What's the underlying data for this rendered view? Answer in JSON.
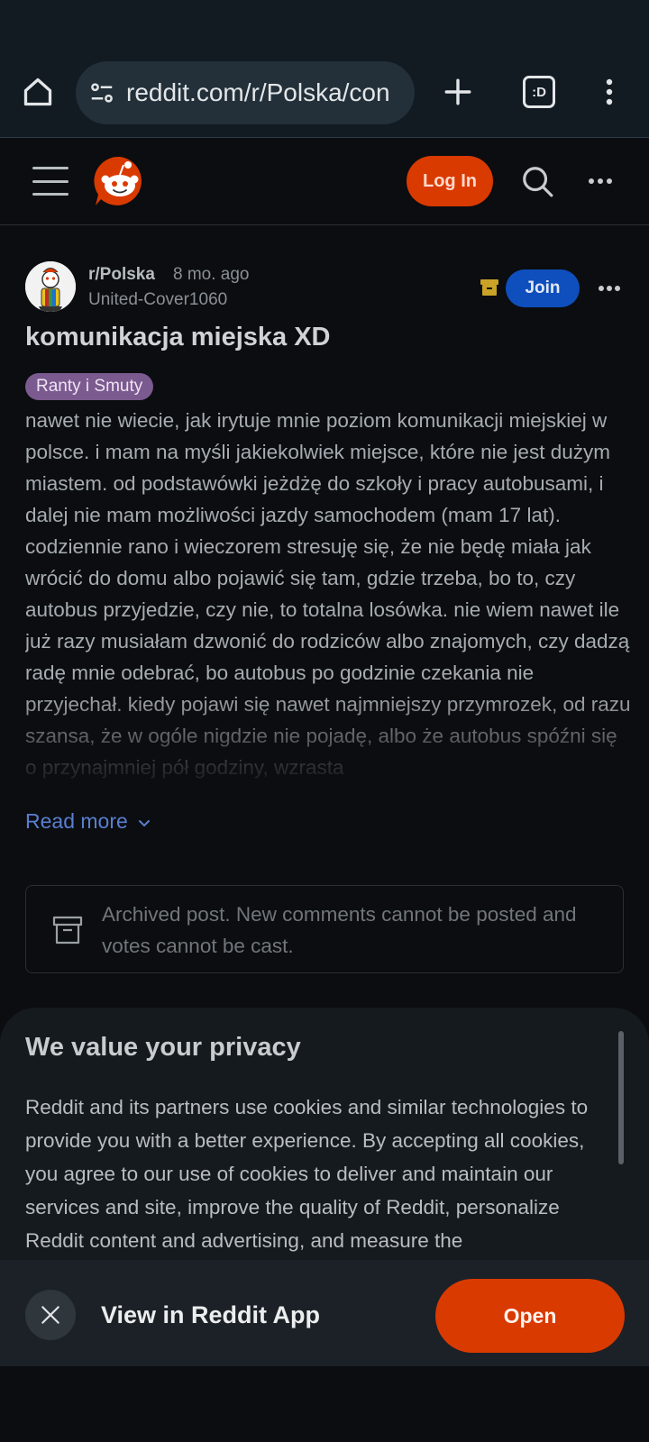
{
  "browser": {
    "url": "reddit.com/r/Polska/con",
    "tabs_label": ":D"
  },
  "header": {
    "login_label": "Log In"
  },
  "post": {
    "subreddit": "r/Polska",
    "time": "8 mo. ago",
    "author": "United-Cover1060",
    "join_label": "Join",
    "title": "komunikacja miejska XD",
    "flair": "Ranty i Smuty",
    "body": "nawet nie wiecie, jak irytuje mnie poziom komunikacji miejskiej w polsce. i mam na myśli jakiekolwiek miejsce, które nie jest dużym miastem. od podstawówki jeżdżę do szkoły i pracy autobusami, i dalej nie mam możliwości jazdy samochodem (mam 17 lat). codziennie rano i wieczorem stresuję się, że nie będę miała jak wrócić do domu albo pojawić się tam, gdzie trzeba, bo to, czy autobus przyjedzie, czy nie, to totalna losówka. nie wiem nawet ile już razy musiałam dzwonić do rodziców albo znajomych, czy dadzą radę mnie odebrać, bo autobus po godzinie czekania nie przyjechał. kiedy pojawi się nawet najmniejszy przymrozek, od razu szansa, że w ogóle nigdzie nie pojadę, albo że autobus spóźni się o przynajmniej pół godziny, wzrasta",
    "read_more_label": "Read more",
    "archived_notice": "Archived post. New comments cannot be posted and votes cannot be cast."
  },
  "privacy": {
    "title": "We value your privacy",
    "text": "Reddit and its partners use cookies and similar technologies to provide you with a better experience. By accepting all cookies, you agree to our use of cookies to deliver and maintain our services and site, improve the quality of Reddit, personalize Reddit content and advertising, and measure the"
  },
  "app_banner": {
    "text": "View in Reddit App",
    "open_label": "Open"
  },
  "colors": {
    "accent": "#d93a00",
    "join": "#0f4fbd",
    "link": "#5a7fd0",
    "flair": "#7b5a8f"
  },
  "icons": [
    "home-icon",
    "site-settings-icon",
    "plus-icon",
    "tabs-icon",
    "kebab-menu-icon",
    "hamburger-icon",
    "reddit-logo",
    "search-icon",
    "more-icon",
    "archive-icon",
    "chevron-down-icon",
    "close-icon"
  ]
}
